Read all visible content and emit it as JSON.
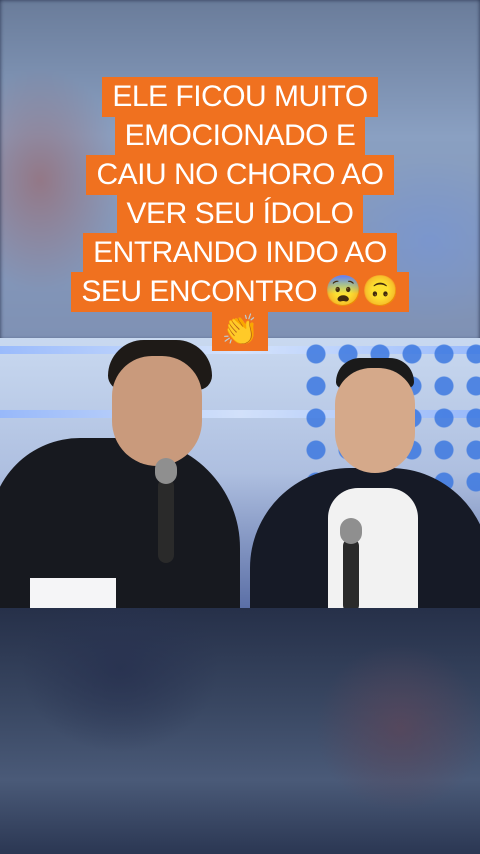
{
  "caption": {
    "lines": [
      "ELE FICOU MUITO",
      "EMOCIONADO  E",
      "CAIU NO CHORO AO",
      "VER SEU ÍDOLO",
      "ENTRANDO INDO AO",
      "SEU ENCONTRO 😨🙃",
      "👏"
    ],
    "background_color": "#f0711f",
    "text_color": "#ffffff"
  },
  "video": {
    "scene": "tv-studio-two-people-with-microphones"
  }
}
